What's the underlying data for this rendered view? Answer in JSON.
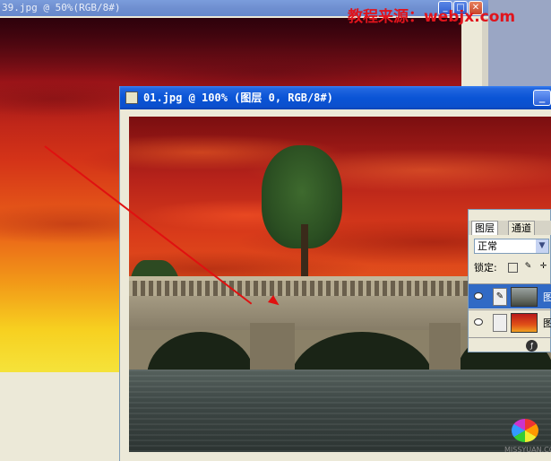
{
  "back_window": {
    "title": "39.jpg @ 50%(RGB/8#)"
  },
  "watermark": "教程来源：webjx.com",
  "front_window": {
    "title": "01.jpg @ 100% (图层 0, RGB/8#)",
    "minimize_glyph": "_"
  },
  "layers_panel": {
    "tabs": [
      "图层",
      "通道"
    ],
    "blend_mode": "正常",
    "lock_label": "锁定:",
    "layers": [
      {
        "name": "图",
        "thumbnail": "bridge-photo",
        "selected": true
      },
      {
        "name": "图",
        "thumbnail": "sky-photo",
        "selected": false
      }
    ]
  },
  "logo": {
    "text": "MISSYUAN.COM"
  },
  "colors": {
    "accent_red": "#e01010",
    "title_blue": "#0a54d6",
    "selected_layer": "#316ac5"
  }
}
